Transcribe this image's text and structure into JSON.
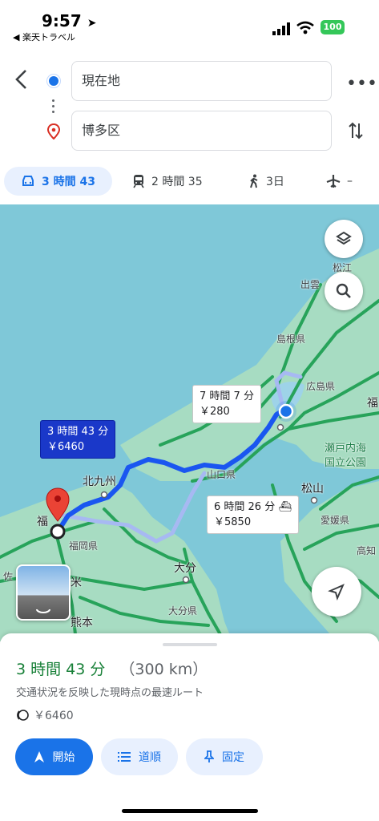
{
  "status": {
    "time": "9:57",
    "back_app": "◀ 楽天トラベル",
    "battery": "100"
  },
  "search": {
    "origin": "現在地",
    "destination": "博多区"
  },
  "modes": [
    {
      "label": "3 時間 43",
      "icon": "car-icon"
    },
    {
      "label": "2 時間 35",
      "icon": "train-icon"
    },
    {
      "label": "3日",
      "icon": "walk-icon"
    },
    {
      "label": "–",
      "icon": "plane-icon"
    }
  ],
  "map": {
    "routes": [
      {
        "time": "3 時間 43 分",
        "toll": "￥6460",
        "selected": true
      },
      {
        "time": "7 時間 7 分",
        "toll": "￥280"
      },
      {
        "time": "6 時間 26 分",
        "toll": "￥5850",
        "ferry": true
      }
    ],
    "labels": {
      "matsue": "松江",
      "izumo": "出雲",
      "shimane": "島根県",
      "hiroshima": "広島県",
      "fuku": "福",
      "setonaikai1": "瀬戸内海",
      "setonaikai2": "国立公園",
      "kitakyushu": "北九州",
      "yamaguchi": "山口県",
      "matsuyama": "松山",
      "ehime": "愛媛県",
      "kochi": "高知",
      "fukuoka_city": "福",
      "fukuoka": "福岡県",
      "kume": "米",
      "oita_city": "大分",
      "oita": "大分県",
      "kumamoto": "熊本",
      "saga": "佐"
    },
    "colors": {
      "sea": "#7fc8d8",
      "land": "#a7dcc2",
      "highway": "#27a35a",
      "route": "#1a56f0",
      "alt_route": "#a7b9f2"
    }
  },
  "sheet": {
    "time": "3 時間 43 分",
    "distance": "（300 km）",
    "subtitle": "交通状況を反映した現時点の最速ルート",
    "toll": "￥6460",
    "start": "開始",
    "steps": "道順",
    "pin": "固定"
  }
}
